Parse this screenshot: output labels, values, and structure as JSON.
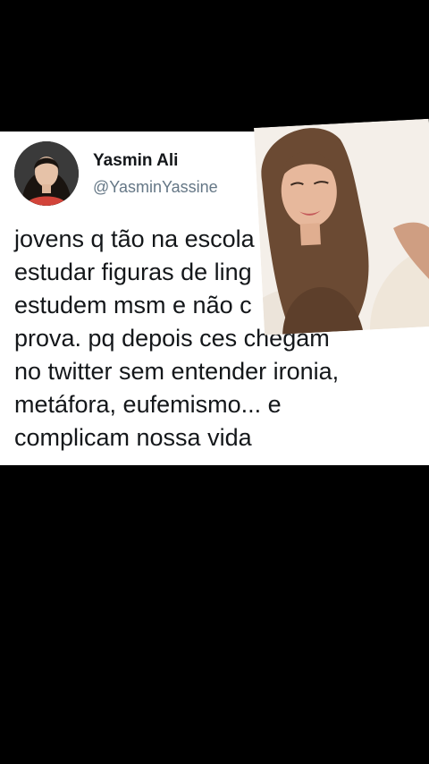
{
  "tweet": {
    "display_name": "Yasmin Ali",
    "handle": "@YasminYassine",
    "text_lines": [
      "jovens q tão na escola",
      "estudar figuras de ling",
      "estudem msm  e não c",
      "prova. pq depois ces chegam",
      "no twitter sem entender ironia,",
      "metáfora, eufemismo... e",
      "complicam nossa vida"
    ]
  },
  "icons": {
    "menu": "chevron-down-icon"
  },
  "colors": {
    "background": "#000000",
    "card": "#ffffff",
    "text": "#14171a",
    "handle": "#657786"
  }
}
